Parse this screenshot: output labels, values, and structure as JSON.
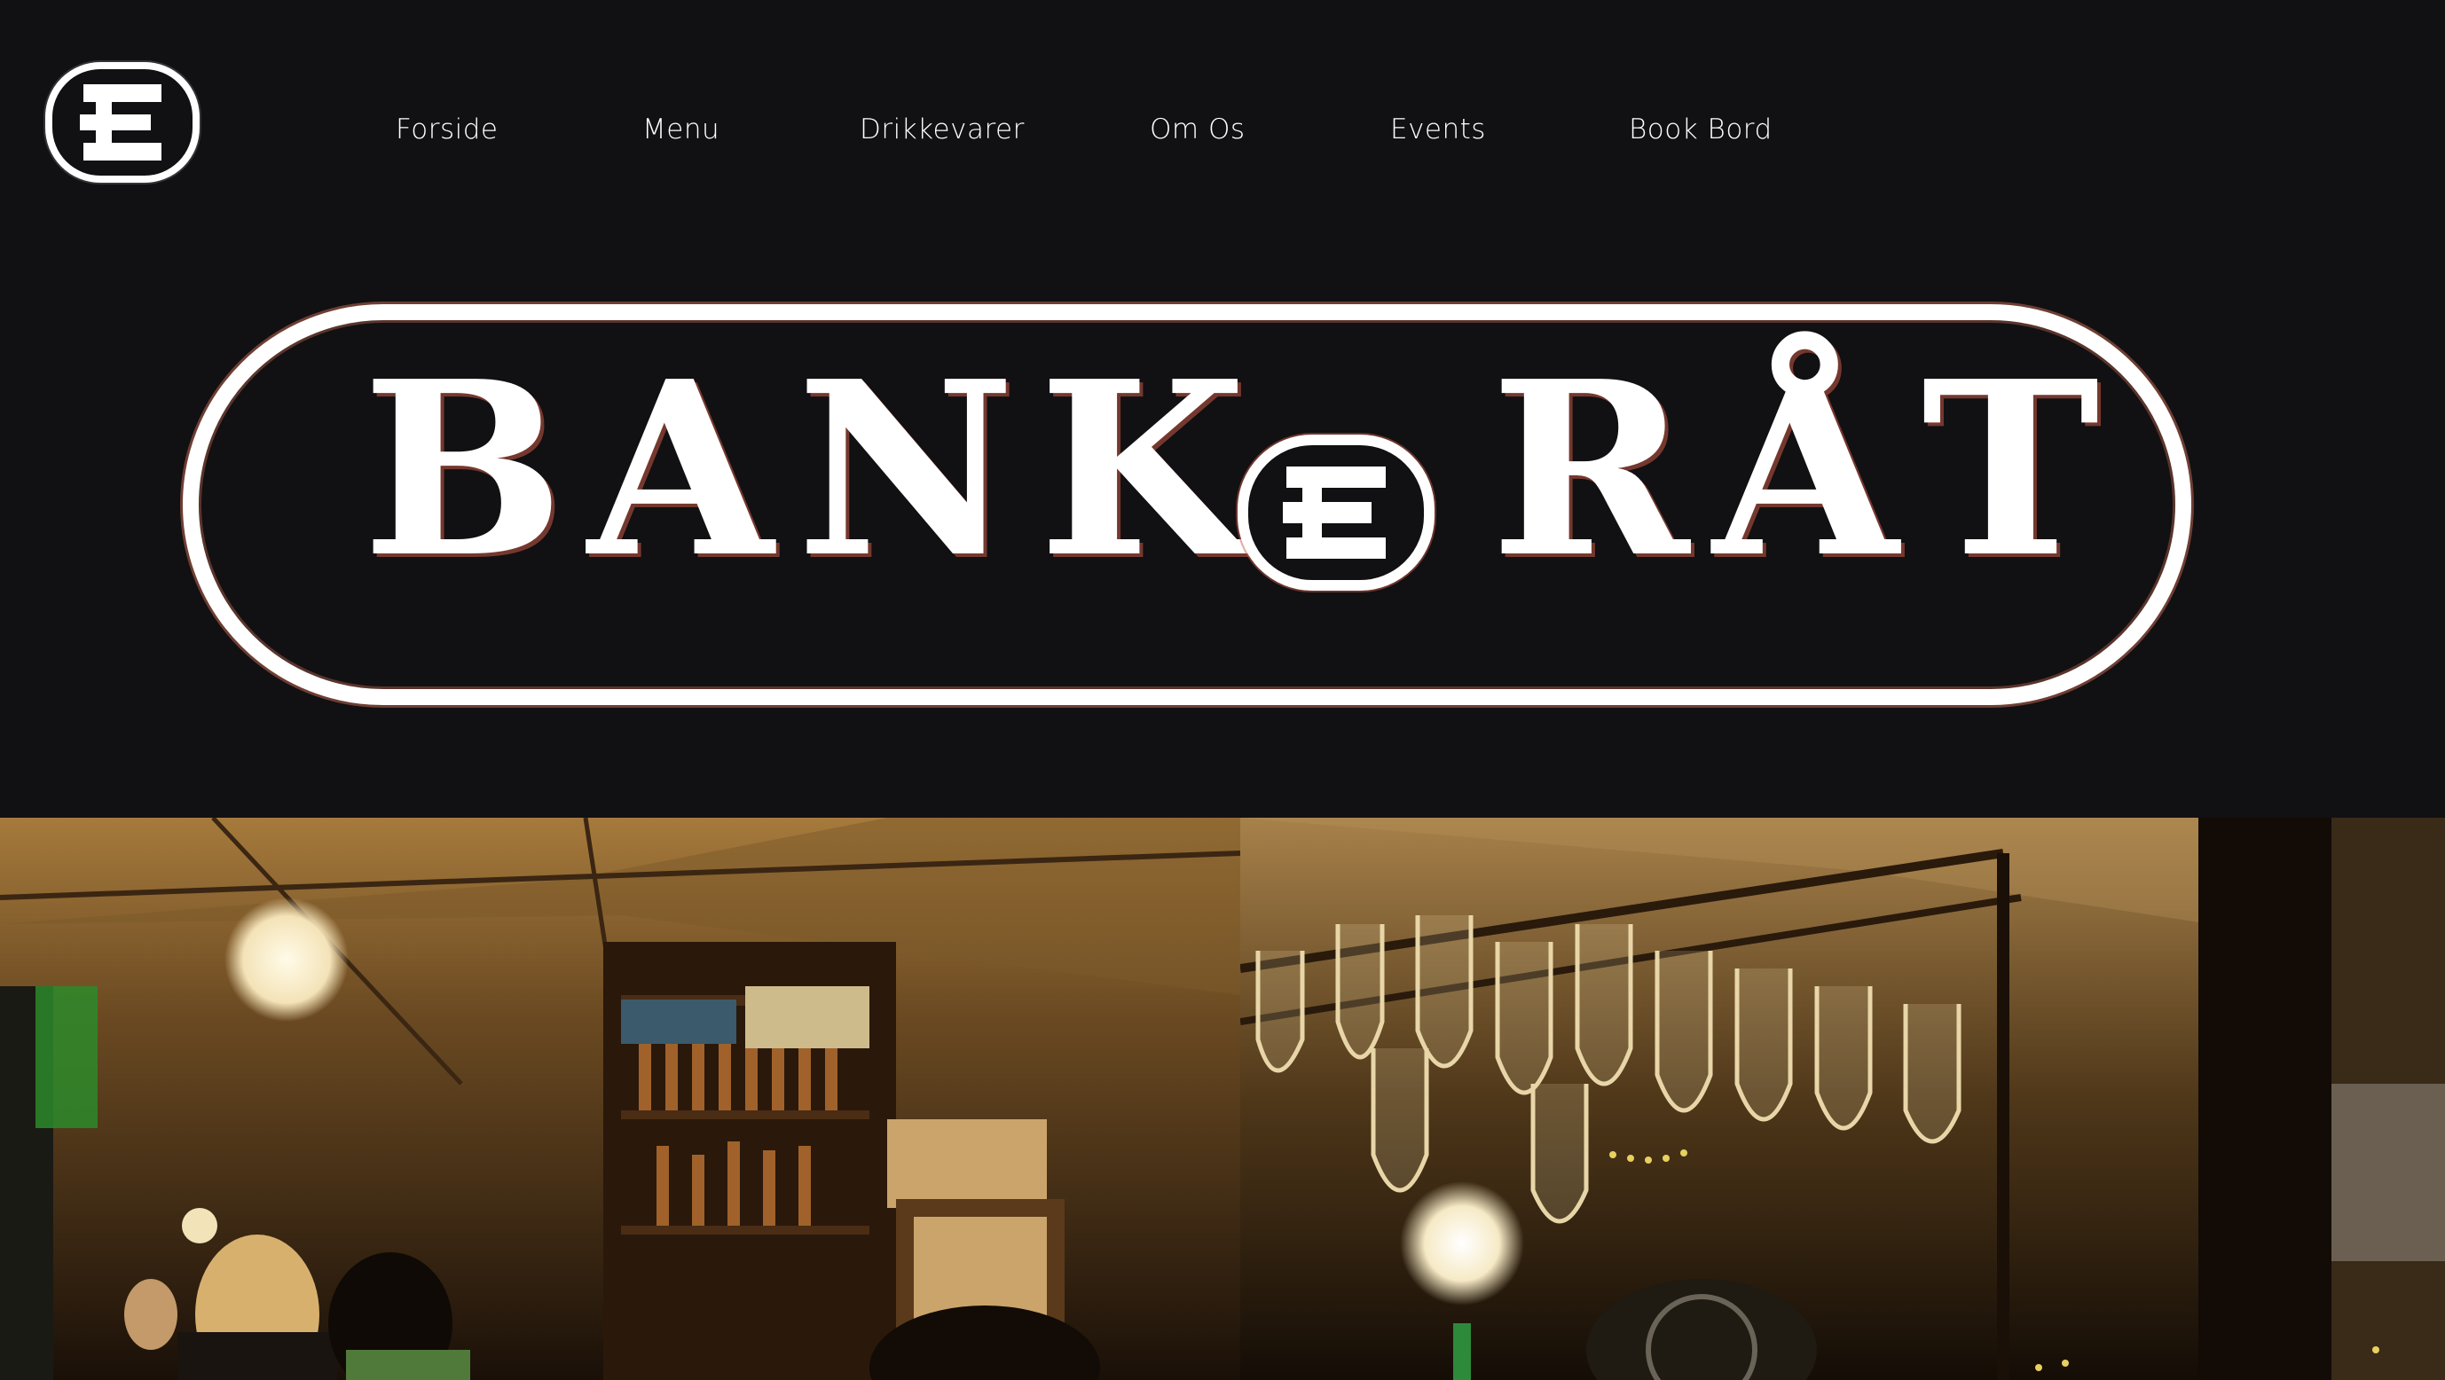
{
  "logo": {
    "icon": "e-monogram-icon"
  },
  "nav": {
    "items": [
      {
        "label": "Forside"
      },
      {
        "label": "Menu"
      },
      {
        "label": "Drikkevarer"
      },
      {
        "label": "Om Os"
      },
      {
        "label": "Events"
      },
      {
        "label": "Book Bord"
      }
    ]
  },
  "hero": {
    "brand_left": "BANK",
    "brand_right": "RÅT",
    "brand_icon": "e-monogram-icon"
  },
  "photos": [
    {
      "name": "bar-interior-photo",
      "icon": "photo-icon"
    },
    {
      "name": "hanging-glasses-photo",
      "icon": "photo-icon"
    }
  ],
  "colors": {
    "background": "#111013",
    "foreground": "#ffffff",
    "accent_glow": "#e1785a",
    "photo_warm": "#c8a060"
  }
}
